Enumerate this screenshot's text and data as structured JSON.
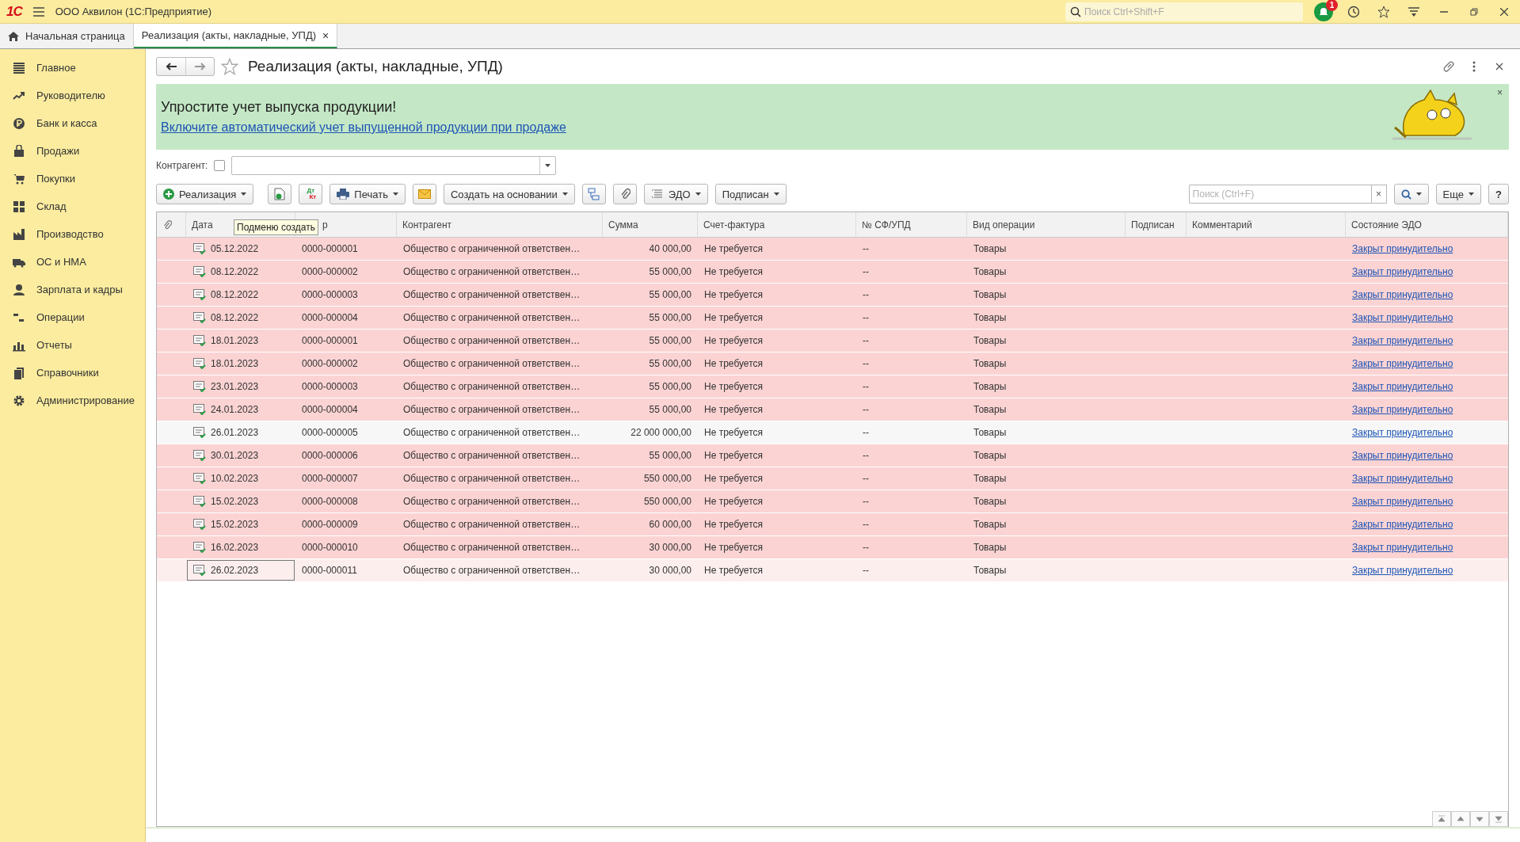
{
  "title_bar": {
    "logo": "1С",
    "title": "ООО Аквилон  (1С:Предприятие)",
    "search_placeholder": "Поиск Ctrl+Shift+F",
    "notification_count": "1"
  },
  "tabs": [
    {
      "label": "Начальная страница",
      "kind": "home",
      "selected": false
    },
    {
      "label": "Реализация (акты, накладные, УПД)",
      "kind": "doc",
      "selected": true,
      "close": "×"
    }
  ],
  "sidebar": {
    "items": [
      {
        "label": "Главное",
        "kind": "menu"
      },
      {
        "label": "Руководителю",
        "kind": "trend"
      },
      {
        "label": "Банк и касса",
        "kind": "coin"
      },
      {
        "label": "Продажи",
        "kind": "bag"
      },
      {
        "label": "Покупки",
        "kind": "cart"
      },
      {
        "label": "Склад",
        "kind": "grid"
      },
      {
        "label": "Производство",
        "kind": "factory"
      },
      {
        "label": "ОС и НМА",
        "kind": "truck"
      },
      {
        "label": "Зарплата и кадры",
        "kind": "person"
      },
      {
        "label": "Операции",
        "kind": "dtkt"
      },
      {
        "label": "Отчеты",
        "kind": "bars"
      },
      {
        "label": "Справочники",
        "kind": "books"
      },
      {
        "label": "Администрирование",
        "kind": "gear"
      }
    ]
  },
  "form": {
    "title": "Реализация (акты, накладные, УПД)",
    "favorite": false,
    "banner": {
      "heading": "Упростите учет выпуска продукции!",
      "link": "Включите автоматический учет выпущенной продукции при продаже",
      "close": "×"
    },
    "filter": {
      "label": "Контрагент:",
      "checked": false
    },
    "toolbar": [
      {
        "kind": "create",
        "label": "Реализация"
      },
      {
        "kind": "copy"
      },
      {
        "kind": "dtkt",
        "label": "Дт",
        "label2": "Кт"
      },
      {
        "kind": "print",
        "label": "Печать"
      },
      {
        "kind": "mail"
      },
      {
        "kind": "menu",
        "label": "Создать на основании"
      },
      {
        "kind": "struct"
      },
      {
        "kind": "clip"
      },
      {
        "kind": "edo",
        "label": "ЭДО"
      },
      {
        "kind": "menu",
        "label": "Подписан"
      }
    ],
    "search": {
      "placeholder": "Поиск (Ctrl+F)",
      "clear": "×"
    },
    "more": "Еще",
    "help": "?",
    "tooltip": "Подменю создать",
    "table": {
      "columns": [
        "",
        "Дата",
        "р",
        "Контрагент",
        "Сумма",
        "Счет-фактура",
        "№ СФ/УПД",
        "Вид операции",
        "Подписан",
        "Комментарий",
        "Состояние ЭДО"
      ],
      "rows": [
        {
          "date": "05.12.2022",
          "number": "0000-000001",
          "counterparty": "Общество с ограниченной ответствен…",
          "sum": "40 000,00",
          "invoice": "Не требуется",
          "sf": "--",
          "operation": "Товары",
          "edo": "Закрыт принудительно",
          "highlighted": true,
          "selected": false
        },
        {
          "date": "08.12.2022",
          "number": "0000-000002",
          "counterparty": "Общество с ограниченной ответствен…",
          "sum": "55 000,00",
          "invoice": "Не требуется",
          "sf": "--",
          "operation": "Товары",
          "edo": "Закрыт принудительно",
          "highlighted": true,
          "selected": false
        },
        {
          "date": "08.12.2022",
          "number": "0000-000003",
          "counterparty": "Общество с ограниченной ответствен…",
          "sum": "55 000,00",
          "invoice": "Не требуется",
          "sf": "--",
          "operation": "Товары",
          "edo": "Закрыт принудительно",
          "highlighted": true,
          "selected": false
        },
        {
          "date": "08.12.2022",
          "number": "0000-000004",
          "counterparty": "Общество с ограниченной ответствен…",
          "sum": "55 000,00",
          "invoice": "Не требуется",
          "sf": "--",
          "operation": "Товары",
          "edo": "Закрыт принудительно",
          "highlighted": true,
          "selected": false
        },
        {
          "date": "18.01.2023",
          "number": "0000-000001",
          "counterparty": "Общество с ограниченной ответствен…",
          "sum": "55 000,00",
          "invoice": "Не требуется",
          "sf": "--",
          "operation": "Товары",
          "edo": "Закрыт принудительно",
          "highlighted": true,
          "selected": false
        },
        {
          "date": "18.01.2023",
          "number": "0000-000002",
          "counterparty": "Общество с ограниченной ответствен…",
          "sum": "55 000,00",
          "invoice": "Не требуется",
          "sf": "--",
          "operation": "Товары",
          "edo": "Закрыт принудительно",
          "highlighted": true,
          "selected": false
        },
        {
          "date": "23.01.2023",
          "number": "0000-000003",
          "counterparty": "Общество с ограниченной ответствен…",
          "sum": "55 000,00",
          "invoice": "Не требуется",
          "sf": "--",
          "operation": "Товары",
          "edo": "Закрыт принудительно",
          "highlighted": true,
          "selected": false
        },
        {
          "date": "24.01.2023",
          "number": "0000-000004",
          "counterparty": "Общество с ограниченной ответствен…",
          "sum": "55 000,00",
          "invoice": "Не требуется",
          "sf": "--",
          "operation": "Товары",
          "edo": "Закрыт принудительно",
          "highlighted": true,
          "selected": false
        },
        {
          "date": "26.01.2023",
          "number": "0000-000005",
          "counterparty": "Общество с ограниченной ответствен…",
          "sum": "22 000 000,00",
          "invoice": "Не требуется",
          "sf": "--",
          "operation": "Товары",
          "edo": "Закрыт принудительно",
          "highlighted": false,
          "selected": false
        },
        {
          "date": "30.01.2023",
          "number": "0000-000006",
          "counterparty": "Общество с ограниченной ответствен…",
          "sum": "55 000,00",
          "invoice": "Не требуется",
          "sf": "--",
          "operation": "Товары",
          "edo": "Закрыт принудительно",
          "highlighted": true,
          "selected": false
        },
        {
          "date": "10.02.2023",
          "number": "0000-000007",
          "counterparty": "Общество с ограниченной ответствен…",
          "sum": "550 000,00",
          "invoice": "Не требуется",
          "sf": "--",
          "operation": "Товары",
          "edo": "Закрыт принудительно",
          "highlighted": true,
          "selected": false
        },
        {
          "date": "15.02.2023",
          "number": "0000-000008",
          "counterparty": "Общество с ограниченной ответствен…",
          "sum": "550 000,00",
          "invoice": "Не требуется",
          "sf": "--",
          "operation": "Товары",
          "edo": "Закрыт принудительно",
          "highlighted": true,
          "selected": false
        },
        {
          "date": "15.02.2023",
          "number": "0000-000009",
          "counterparty": "Общество с ограниченной ответствен…",
          "sum": "60 000,00",
          "invoice": "Не требуется",
          "sf": "--",
          "operation": "Товары",
          "edo": "Закрыт принудительно",
          "highlighted": true,
          "selected": false
        },
        {
          "date": "16.02.2023",
          "number": "0000-000010",
          "counterparty": "Общество с ограниченной ответствен…",
          "sum": "30 000,00",
          "invoice": "Не требуется",
          "sf": "--",
          "operation": "Товары",
          "edo": "Закрыт принудительно",
          "highlighted": true,
          "selected": false
        },
        {
          "date": "26.02.2023",
          "number": "0000-000011",
          "counterparty": "Общество с ограниченной ответствен…",
          "sum": "30 000,00",
          "invoice": "Не требуется",
          "sf": "--",
          "operation": "Товары",
          "edo": "Закрыт принудительно",
          "highlighted": true,
          "selected": true
        }
      ]
    }
  }
}
